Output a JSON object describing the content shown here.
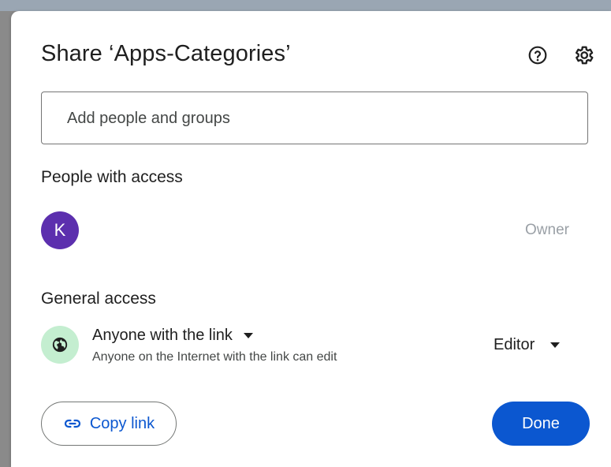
{
  "dialog": {
    "title": "Share ‘Apps-Categories’",
    "help_icon": "help-circle-icon",
    "settings_icon": "gear-icon"
  },
  "add_people": {
    "placeholder": "Add people and groups",
    "value": ""
  },
  "people_with_access": {
    "heading": "People with access",
    "people": [
      {
        "avatar_initial": "K",
        "avatar_color": "#5c2fae",
        "role": "Owner"
      }
    ]
  },
  "general_access": {
    "heading": "General access",
    "icon": "globe-icon",
    "icon_bg": "#c4eed0",
    "link_setting": "Anyone with the link",
    "description": "Anyone on the Internet with the link can edit",
    "role": "Editor"
  },
  "actions": {
    "copy_link_label": "Copy link",
    "copy_link_icon": "link-icon",
    "done_label": "Done"
  },
  "colors": {
    "primary": "#0b57d0",
    "text": "#1f1f1f",
    "muted": "#9aa0a6"
  }
}
